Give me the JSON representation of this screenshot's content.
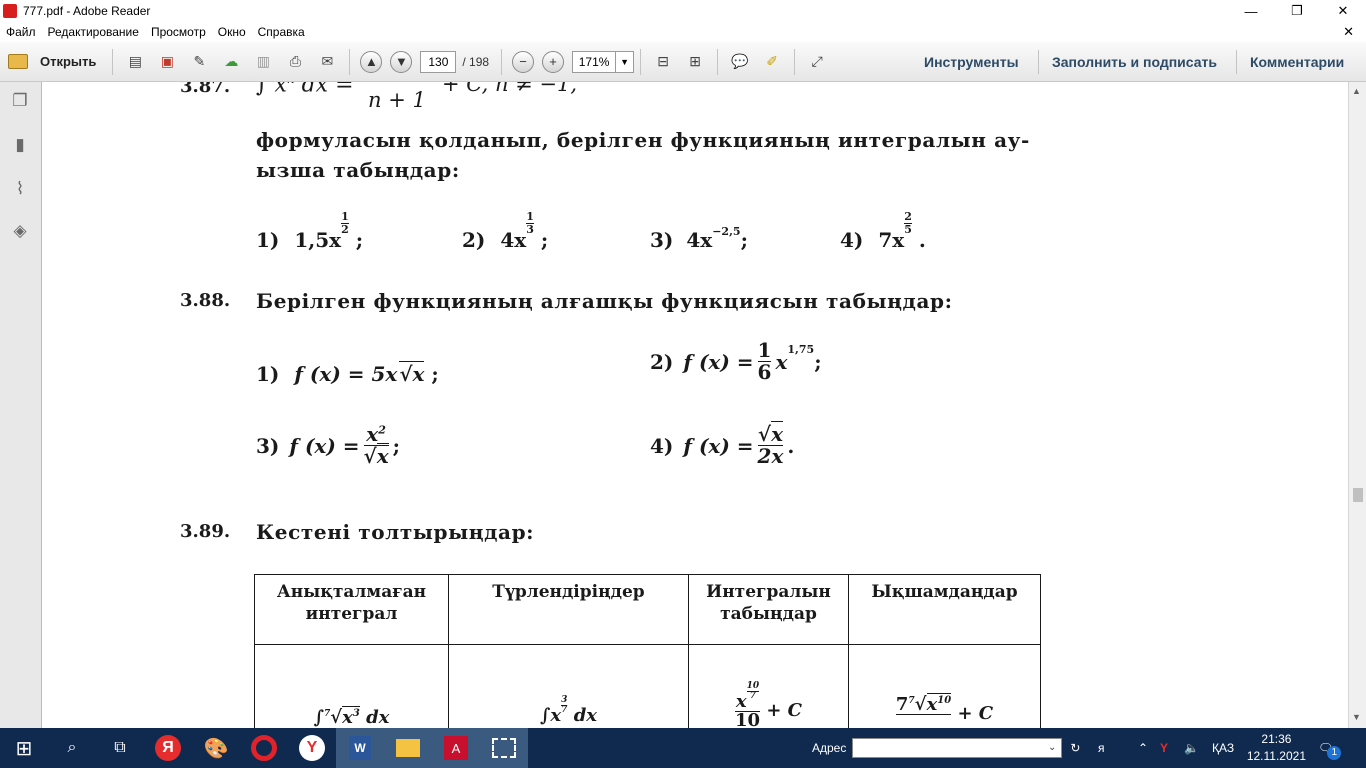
{
  "window": {
    "title": "777.pdf - Adobe Reader"
  },
  "menu": [
    "Файл",
    "Редактирование",
    "Просмотр",
    "Окно",
    "Справка"
  ],
  "toolbar": {
    "open_label": "Открыть",
    "page_current": "130",
    "page_total": "/ 198",
    "zoom": "171%",
    "tools_label": "Инструменты",
    "fill_sign_label": "Заполнить и подписать",
    "comments_label": "Комментарии"
  },
  "doc": {
    "p387": {
      "num": "3.87.",
      "formula_denominator": "n + 1",
      "formula_tail": "+ C,  n ≠ −1,",
      "text_line1": "формуласын қолданып, берілген функцияның интегралын ау-",
      "text_line2": "ызша табыңдар:",
      "items": [
        {
          "label": "1)",
          "base": "1,5x",
          "exp_num": "1",
          "exp_den": "2",
          "tail": ";"
        },
        {
          "label": "2)",
          "base": "4x",
          "exp_num": "1",
          "exp_den": "3",
          "tail": ";"
        },
        {
          "label": "3)",
          "base": "4x",
          "exp": "−2,5",
          "tail": ";"
        },
        {
          "label": "4)",
          "base": "7x",
          "exp_num": "2",
          "exp_den": "5",
          "tail": "."
        }
      ]
    },
    "p388": {
      "num": "3.88.",
      "text": "Берілген функцияның алғашқы функциясын табыңдар:",
      "items": [
        {
          "label": "1)",
          "fx": "f (x) = 5x",
          "rad": "x",
          "tail": ";"
        },
        {
          "label": "2)",
          "fx": "f (x) =",
          "num": "1",
          "den": "6",
          "base": "x",
          "exp": "1,75",
          "tail": ";"
        },
        {
          "label": "3)",
          "fx": "f (x) =",
          "num": "x",
          "num_exp": "2",
          "den_rad": "x",
          "tail": ";"
        },
        {
          "label": "4)",
          "fx": "f (x) =",
          "num_rad": "x",
          "den": "2x",
          "tail": "."
        }
      ]
    },
    "p389": {
      "num": "3.89.",
      "text": "Кестені толтырыңдар:",
      "headers": [
        "Анықталмаған интеграл",
        "Түрлендіріңдер",
        "Интегралын табыңдар",
        "Ықшамдаңдар"
      ],
      "row1": {
        "c1": "dx",
        "c1_root_index": "7",
        "c1_rad": "x",
        "c1_rad_exp": "3",
        "c2": "dx",
        "c2_base": "x",
        "c2_exp_num": "3",
        "c2_exp_den": "7",
        "c3_base": "x",
        "c3_exp_num": "10",
        "c3_exp_den": "7",
        "c3_den": "10",
        "c3_tail": "+ C",
        "c4_coef": "7",
        "c4_root_index": "7",
        "c4_rad": "x",
        "c4_rad_exp": "10",
        "c4_tail": "+ C"
      }
    }
  },
  "taskbar": {
    "address_label": "Адрес",
    "lang": "ҚАЗ",
    "time": "21:36",
    "date": "12.11.2021",
    "notify_count": "1"
  }
}
